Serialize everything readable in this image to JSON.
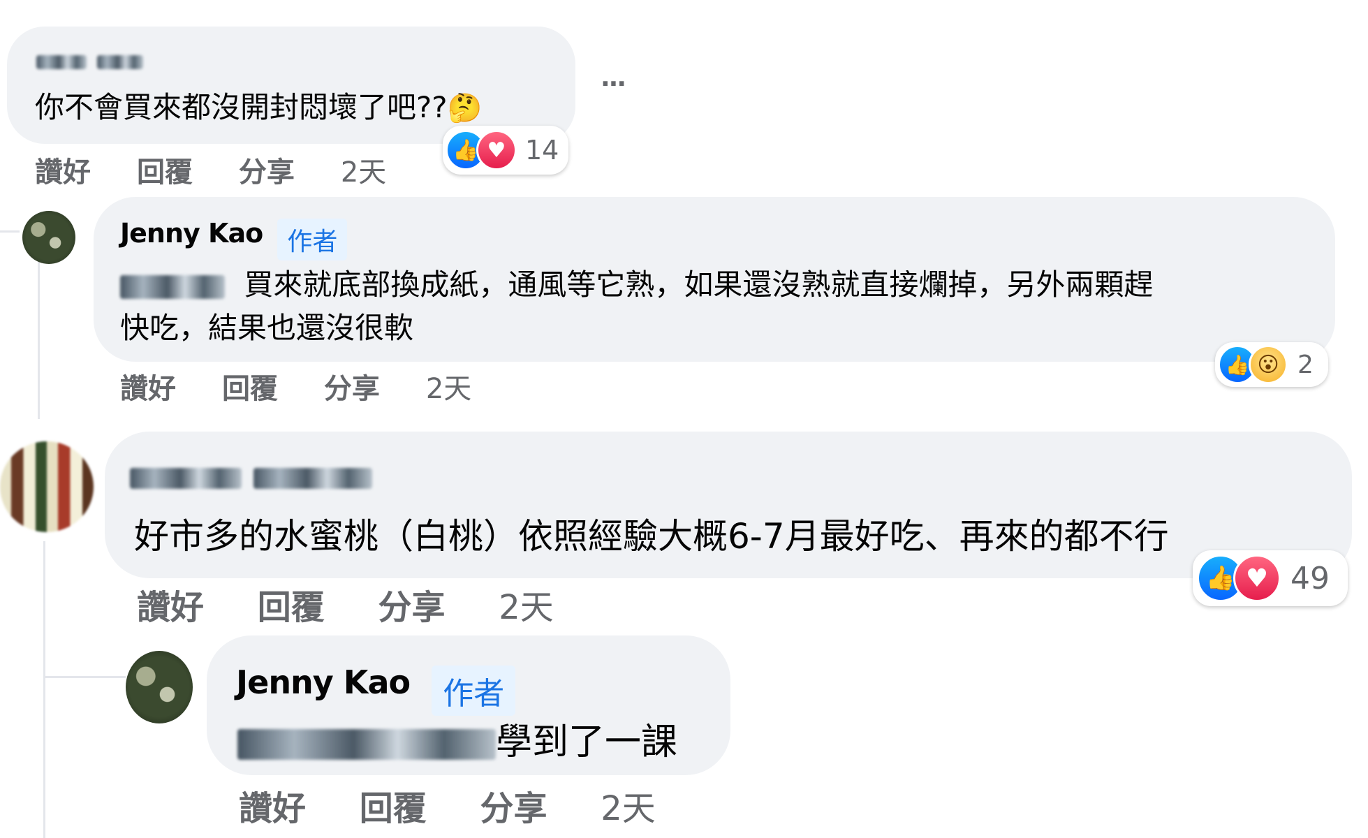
{
  "comments": [
    {
      "author_blurred": true,
      "text": "你不會買來都沒開封悶壞了吧??",
      "emoji": "🤔",
      "reactions": [
        "like-icon",
        "love-icon"
      ],
      "reaction_count": "14",
      "actions": {
        "like": "讚好",
        "reply": "回覆",
        "share": "分享",
        "time": "2天"
      },
      "more": "···"
    },
    {
      "author": "Jenny Kao",
      "badge": "作者",
      "text": "買來就底部換成紙，通風等它熟，如果還沒熟就直接爛掉，另外兩顆趕",
      "text_line2": "快吃，結果也還沒很軟",
      "reactions": [
        "like-icon",
        "wow-icon"
      ],
      "reaction_count": "2",
      "actions": {
        "like": "讚好",
        "reply": "回覆",
        "share": "分享",
        "time": "2天"
      }
    },
    {
      "author_blurred": true,
      "text": "好市多的水蜜桃（白桃）依照經驗大概6-7月最好吃、再來的都不行",
      "reactions": [
        "like-icon",
        "love-icon"
      ],
      "reaction_count": "49",
      "actions": {
        "like": "讚好",
        "reply": "回覆",
        "share": "分享",
        "time": "2天"
      }
    },
    {
      "author": "Jenny Kao",
      "badge": "作者",
      "text": "學到了一課",
      "actions": {
        "like": "讚好",
        "reply": "回覆",
        "share": "分享",
        "time": "2天"
      }
    }
  ],
  "colors": {
    "bubble": "#f0f2f5",
    "secondary_text": "#65676b",
    "like": "#0866ff",
    "love": "#e61e4d",
    "badge_bg": "#e7f3ff",
    "badge_text": "#1b74e4"
  }
}
